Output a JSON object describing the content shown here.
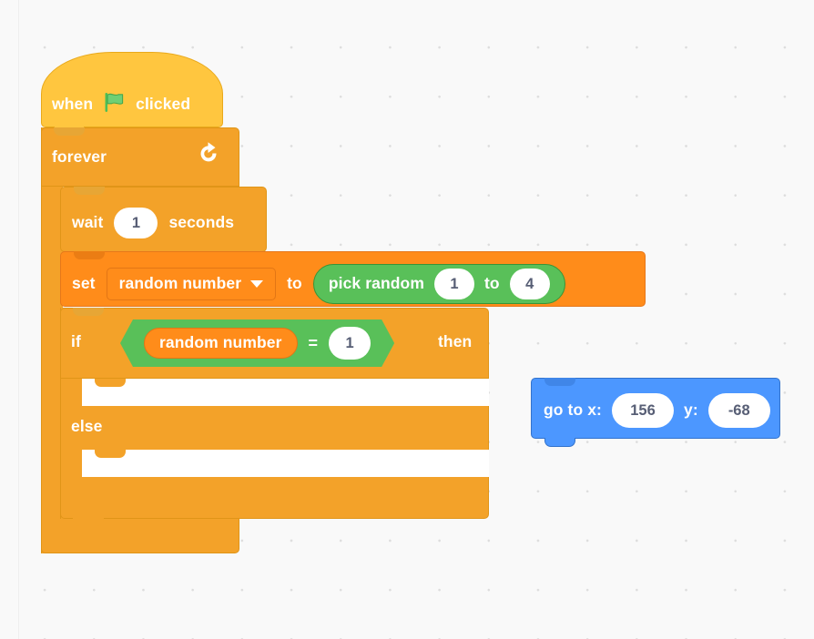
{
  "workspace": {
    "background_color": "#F9F9F9",
    "grid_dot_color": "#DDDDDD"
  },
  "palette": {
    "events_color": "#FFC63F",
    "control_color": "#F3A229",
    "variables_color": "#FF8C1A",
    "operators_color": "#59C059",
    "motion_color": "#4C97FF",
    "input_text_color": "#575E75"
  },
  "script": {
    "hat": {
      "prefix_label": "when",
      "icon": "green-flag-icon",
      "suffix_label": "clicked"
    },
    "forever": {
      "label": "forever",
      "icon": "loop-arrow-icon"
    },
    "wait": {
      "label": "wait",
      "value": "1",
      "units_label": "seconds"
    },
    "set_variable": {
      "label": "set",
      "variable_name": "random number",
      "dropdown_icon": "chevron-down-icon",
      "to_label": "to",
      "operator": {
        "label": "pick random",
        "from_value": "1",
        "to_label": "to",
        "to_value": "4"
      }
    },
    "if_else": {
      "if_label": "if",
      "then_label": "then",
      "else_label": "else",
      "condition": {
        "left_operand": "random number",
        "operator_symbol": "=",
        "right_operand": "1"
      }
    }
  },
  "loose_blocks": {
    "go_to_xy": {
      "label": "go to x:",
      "x_value": "156",
      "y_label": "y:",
      "y_value": "-68"
    }
  }
}
